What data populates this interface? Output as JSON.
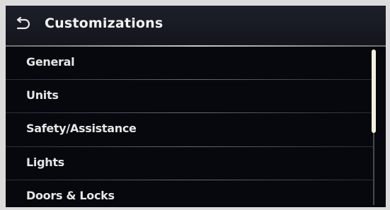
{
  "header": {
    "title": "Customizations",
    "back_icon": "back-arrow-icon"
  },
  "menu": {
    "items": [
      {
        "label": "General"
      },
      {
        "label": "Units"
      },
      {
        "label": "Safety/Assistance"
      },
      {
        "label": "Lights"
      },
      {
        "label": "Doors & Locks"
      }
    ]
  },
  "scrollbar": {
    "visible_fraction": 0.54,
    "position": 0
  },
  "colors": {
    "background": "#07080d",
    "header": "#1a1c25",
    "text": "#e6e6e6",
    "scroll_thumb": "#f3efe0"
  }
}
